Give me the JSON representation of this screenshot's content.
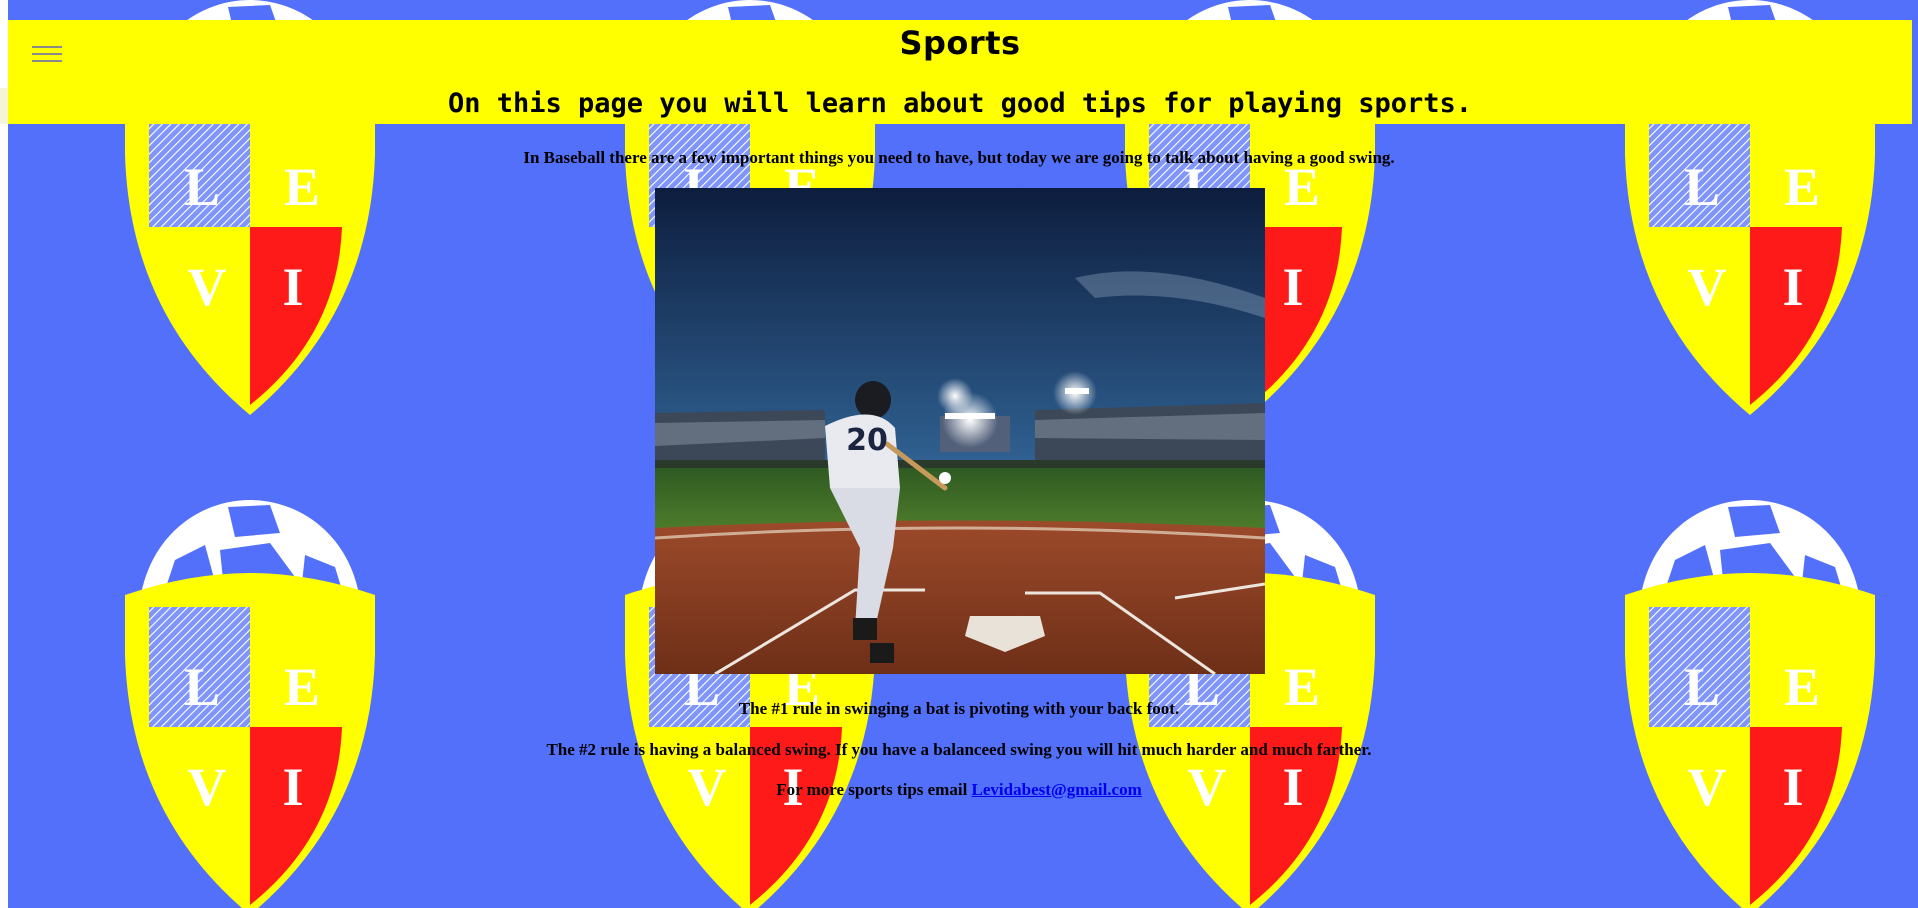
{
  "header": {
    "menu_icon": "hamburger-menu-icon",
    "title": "Sports",
    "subtitle": "On this page you will learn about good tips for playing sports."
  },
  "content": {
    "intro": "In Baseball there are a few important things you need to have, but today we are going to talk about having a good swing.",
    "rule1": "The #1 rule in swinging a bat is pivoting with your back foot.",
    "rule2": "The #2 rule is having a balanced swing. If you have a balanceed swing you will hit much harder and much farther.",
    "contact_prefix": "For more sports tips email ",
    "contact_email": "Levidabest@gmail.com"
  },
  "image": {
    "jersey_number": "20"
  },
  "background": {
    "crest_letters": [
      "L",
      "E",
      "V",
      "I"
    ]
  },
  "colors": {
    "page_background": "#5270fa",
    "header_background": "#ffff00",
    "crest_yellow": "#ffff00",
    "crest_red": "#ff1a1a",
    "link": "#0000ee"
  }
}
